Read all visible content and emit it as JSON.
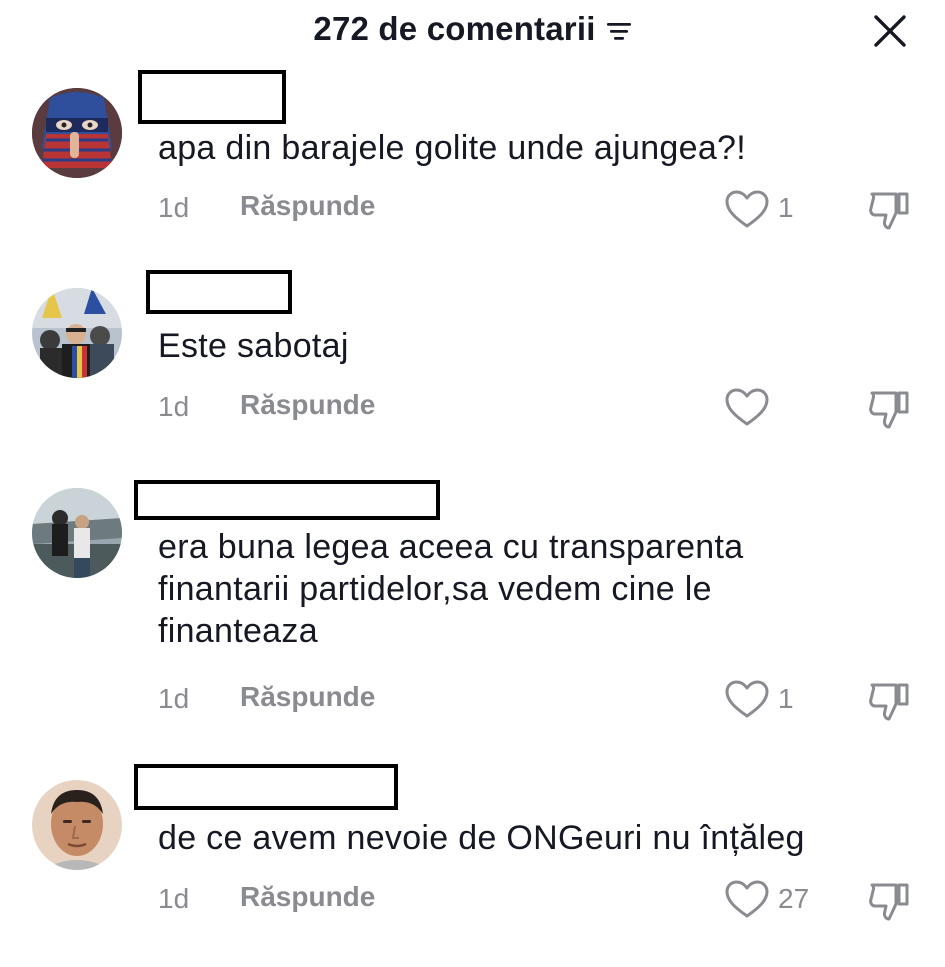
{
  "header": {
    "title": "272 de comentarii"
  },
  "icons": {
    "sort": "sort-lines-icon",
    "close": "close-x-icon",
    "like": "heart-outline-icon",
    "dislike": "thumbs-down-outline-icon"
  },
  "colors": {
    "text": "#161823",
    "muted": "#8a8b91"
  },
  "comments": [
    {
      "text": "apa din barajele golite unde ajungea?!",
      "time": "1d",
      "reply_label": "Răspunde",
      "likes": "1"
    },
    {
      "text": "Este sabotaj",
      "time": "1d",
      "reply_label": "Răspunde",
      "likes": ""
    },
    {
      "text": "era buna legea aceea cu transparenta\nfinantarii partidelor,sa vedem cine le\nfinanteaza",
      "time": "1d",
      "reply_label": "Răspunde",
      "likes": "1"
    },
    {
      "text": "de ce avem nevoie de ONGeuri nu înțăleg",
      "time": "1d",
      "reply_label": "Răspunde",
      "likes": "27"
    }
  ]
}
